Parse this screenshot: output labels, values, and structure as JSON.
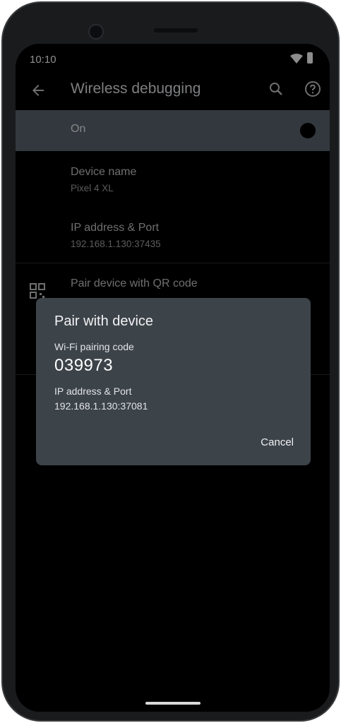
{
  "status_bar": {
    "time": "10:10"
  },
  "app_bar": {
    "title": "Wireless debugging"
  },
  "toggle": {
    "label": "On"
  },
  "settings": {
    "device_name": {
      "title": "Device name",
      "value": "Pixel 4 XL"
    },
    "ip_port": {
      "title": "IP address & Port",
      "value": "192.168.1.130:37435"
    },
    "pair_qr": {
      "title": "Pair device with QR code"
    }
  },
  "dialog": {
    "title": "Pair with device",
    "pairing_code_label": "Wi-Fi pairing code",
    "pairing_code": "039973",
    "ip_label": "IP address & Port",
    "ip_value": "192.168.1.130:37081",
    "cancel_label": "Cancel"
  },
  "colors": {
    "toggle_row_bg": "#5d6771",
    "dialog_bg": "#3c4349",
    "screen_bg": "#000000"
  },
  "icons": [
    "back-arrow-icon",
    "search-icon",
    "help-icon",
    "qr-code-icon",
    "wifi-icon",
    "battery-icon"
  ]
}
